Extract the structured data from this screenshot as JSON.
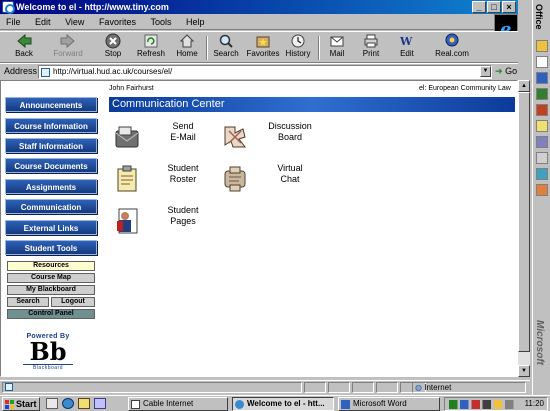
{
  "window": {
    "title": "Welcome to el - http://www.tiny.com",
    "controls": [
      "_",
      "□",
      "×"
    ]
  },
  "menu": [
    "File",
    "Edit",
    "View",
    "Favorites",
    "Tools",
    "Help"
  ],
  "toolbar": [
    {
      "label": "Back",
      "icon": "back-arrow-icon",
      "disabled": false
    },
    {
      "label": "Forward",
      "icon": "forward-arrow-icon",
      "disabled": true
    },
    {
      "label": "Stop",
      "icon": "stop-icon",
      "disabled": false
    },
    {
      "label": "Refresh",
      "icon": "refresh-icon",
      "disabled": false
    },
    {
      "label": "Home",
      "icon": "home-icon",
      "disabled": false
    },
    {
      "label": "Search",
      "icon": "search-icon",
      "disabled": false
    },
    {
      "label": "Favorites",
      "icon": "favorites-icon",
      "disabled": false
    },
    {
      "label": "History",
      "icon": "history-icon",
      "disabled": false
    },
    {
      "label": "Mail",
      "icon": "mail-icon",
      "disabled": false
    },
    {
      "label": "Print",
      "icon": "print-icon",
      "disabled": false
    },
    {
      "label": "Edit",
      "icon": "edit-icon",
      "disabled": false
    },
    {
      "label": "Real.com",
      "icon": "real-icon",
      "disabled": false
    }
  ],
  "address": {
    "label": "Address",
    "value": "http://virtual.hud.ac.uk/courses/el/",
    "go_label": "Go"
  },
  "nav": {
    "buttons": [
      "Announcements",
      "Course Information",
      "Staff Information",
      "Course Documents",
      "Assignments",
      "Communication",
      "External Links",
      "Student Tools"
    ],
    "tools": {
      "resources": "Resources",
      "course_map": "Course Map",
      "my_blackboard": "My Blackboard",
      "search": "Search",
      "logout": "Logout",
      "control_panel": "Control Panel"
    }
  },
  "logo": {
    "powered_by": "Powered By",
    "mark": "Bb",
    "wordmark": "Blackboard"
  },
  "header": {
    "user": "John Fairhurst",
    "course": "el: European Community Law",
    "section_title": "Communication Center"
  },
  "comm_tools": [
    {
      "line1": "Send",
      "line2": "E-Mail",
      "icon": "email-icon"
    },
    {
      "line1": "Discussion",
      "line2": "Board",
      "icon": "discussion-board-icon"
    },
    {
      "line1": "Student",
      "line2": "Roster",
      "icon": "roster-icon"
    },
    {
      "line1": "Virtual",
      "line2": "Chat",
      "icon": "virtual-chat-icon"
    },
    {
      "line1": "Student",
      "line2": "Pages",
      "icon": "student-pages-icon"
    }
  ],
  "status": {
    "zone": "Internet"
  },
  "taskbar": {
    "start": "Start",
    "tasks": [
      "Cable Internet",
      "Welcome to el - htt...",
      "Microsoft Word"
    ],
    "clock": "11:20"
  },
  "office_bar": {
    "title": "Office",
    "brand": "Microsoft"
  },
  "colors": {
    "nav_blue": "#1f4fa0",
    "header_blue": "#0c3b9a",
    "title_bar": "#000080"
  }
}
